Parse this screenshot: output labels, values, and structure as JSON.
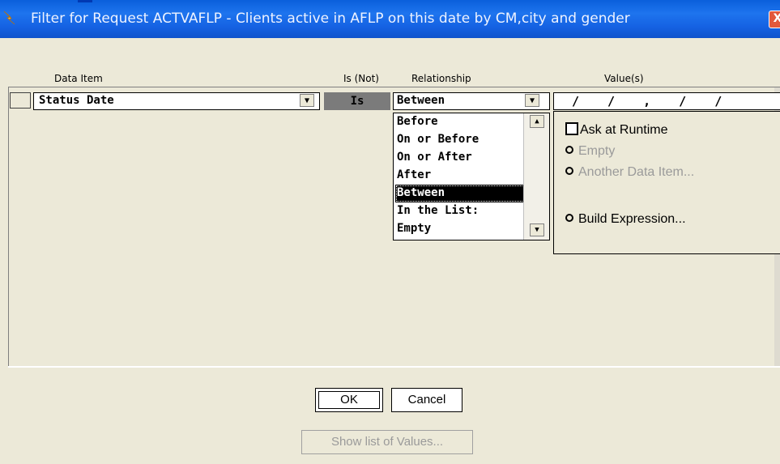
{
  "window": {
    "title": "Filter for Request ACTVAFLP - Clients active in AFLP on this date by CM,city and gender",
    "close_label": "X"
  },
  "headers": {
    "data_item": "Data Item",
    "is_not": "Is (Not)",
    "relationship": "Relationship",
    "values": "Value(s)"
  },
  "row": {
    "data_item": "Status Date",
    "is_not": "Is",
    "relationship": "Between",
    "value": "/ / , / /"
  },
  "relationship_options": [
    "Before",
    "On or Before",
    "On or After",
    "After",
    "Between",
    "In the List:",
    "Empty"
  ],
  "relationship_selected_index": 4,
  "value_options": {
    "ask_at_runtime": "Ask at Runtime",
    "empty": "Empty",
    "another_data_item": "Another Data Item...",
    "build_expression": "Build Expression..."
  },
  "buttons": {
    "ok": "OK",
    "cancel": "Cancel",
    "show_list": "Show list of Values..."
  },
  "icons": {
    "app": "lightning-icon",
    "dropdown": "chevron-down-icon",
    "scroll_up": "arrow-up-icon",
    "scroll_down": "arrow-down-icon"
  }
}
